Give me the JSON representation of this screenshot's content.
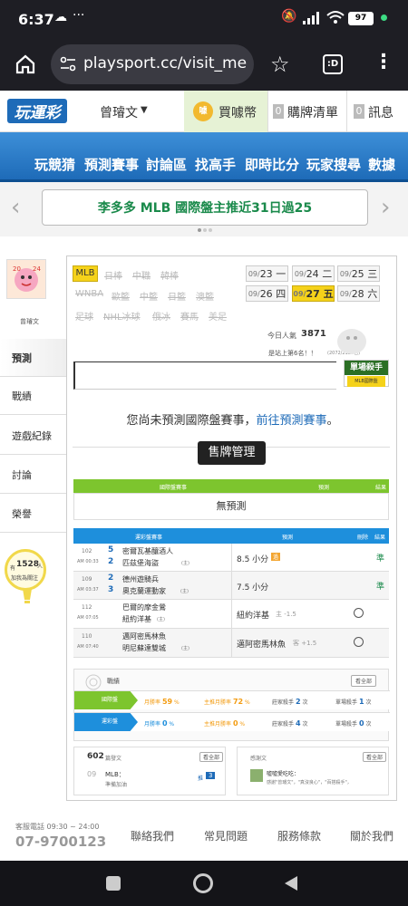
{
  "status": {
    "time": "6:37",
    "battery": "97"
  },
  "browser": {
    "url": "playsport.cc/visit_mer",
    "tab_count": ":D"
  },
  "topnav": {
    "logo": "玩運彩",
    "user": "曾璿文",
    "buy_coin": "買噱幣",
    "cart_count": "0",
    "cart": "購牌清單",
    "msg_count": "0",
    "messages": "訊息"
  },
  "mainnav": [
    "玩競猜",
    "預測賽事",
    "討論區",
    "找高手",
    "即時比分",
    "玩家搜尋",
    "數據"
  ],
  "banner": {
    "text": "李多多 MLB 國際盤主推近31日過25"
  },
  "profile": {
    "name": "曾璿文"
  },
  "sidebar": [
    "預測",
    "戰績",
    "遊戲紀錄",
    "討論",
    "榮譽"
  ],
  "promo": {
    "prefix": "有",
    "count": "1528",
    "unit": "人",
    "sub": "加我為關注"
  },
  "sports": [
    "MLB",
    "日棒",
    "中職",
    "韓棒",
    "WNBA",
    "歐籃",
    "中籃",
    "日籃",
    "澳籃",
    "足球",
    "NHL冰球",
    "俄冰",
    "賽馬",
    "美足"
  ],
  "dates": [
    {
      "md": "09/",
      "d": "23",
      "w": "一"
    },
    {
      "md": "09/",
      "d": "24",
      "w": "二"
    },
    {
      "md": "09/",
      "d": "25",
      "w": "三"
    },
    {
      "md": "09/",
      "d": "26",
      "w": "四"
    },
    {
      "md": "09/",
      "d": "27",
      "w": "五"
    },
    {
      "md": "09/",
      "d": "28",
      "w": "六"
    }
  ],
  "stats": {
    "visitors_label": "今日人氣",
    "visitors": "3871",
    "rank": "是站上第6名！！",
    "rank_sub": "(2072/2124名)"
  },
  "badge": {
    "title": "單場殺手",
    "sub": "MLB國際盤"
  },
  "notice": {
    "text": "您尚未預測國際盤賽事，",
    "link": "前往預測賽事",
    "end": "。"
  },
  "sell_btn": "售牌管理",
  "intl_table": {
    "headers": [
      "國際盤賽事",
      "預測",
      "結果"
    ],
    "empty": "無預測"
  },
  "tw_table": {
    "headers": [
      "運彩盤賽事",
      "預測",
      "刪除",
      "結果"
    ],
    "rows": [
      {
        "no": "102",
        "time": "AM 00:33",
        "s1": "5",
        "s2": "2",
        "t1": "密爾瓦基釀酒人",
        "t2": "匹茲堡海盜",
        "t2_tag": "(主)",
        "pred": "8.5 小分",
        "pred_tag": "過",
        "result": "準"
      },
      {
        "no": "109",
        "time": "AM 03:37",
        "s1": "2",
        "s2": "3",
        "t1": "德州遊騎兵",
        "t2": "奧克蘭運動家",
        "t2_tag": "(主)",
        "pred": "7.5 小分",
        "pred_tag": "",
        "result": "準"
      },
      {
        "no": "112",
        "time": "AM 07:05",
        "s1": "",
        "s2": "",
        "t1": "巴爾的摩金鶯",
        "t2": "紐約洋基",
        "t2_tag": "(主)",
        "pred": "紐約洋基",
        "pred_tag": "主 -1.5",
        "result": ""
      },
      {
        "no": "110",
        "time": "AM 07:40",
        "s1": "",
        "s2": "",
        "t1": "邁阿密馬林魚",
        "t2": "明尼蘇達雙城",
        "t2_tag": "(主)",
        "pred": "邁阿密馬林魚",
        "pred_tag": "客 +1.5",
        "result": ""
      }
    ]
  },
  "record": {
    "title": "戰績",
    "view_all": "看全部",
    "rows": [
      {
        "label": "國際盤",
        "color": "#7dc52e",
        "month": "月勝率",
        "month_v": "59",
        "main": "主推月勝率",
        "main_v": "72",
        "zhuang": "莊家殺手",
        "zhuang_v": "2",
        "single": "單場殺手",
        "single_v": "1",
        "unit": "次"
      },
      {
        "label": "運彩盤",
        "color": "#1e8fdc",
        "month": "月勝率",
        "month_v": "0",
        "main": "主推月勝率",
        "main_v": "0",
        "zhuang": "莊家殺手",
        "zhuang_v": "4",
        "single": "單場殺手",
        "single_v": "0",
        "unit": "次"
      }
    ]
  },
  "posts": {
    "count": "602",
    "label": "篇發文",
    "view_all": "看全部",
    "date": "09",
    "title": "MLB：",
    "sub": "準備加油",
    "badge_label": "推",
    "badge_count": "3"
  },
  "thanks": {
    "title": "感謝文",
    "view_all": "看全部",
    "name": "噓噓愛吃吃：",
    "text": "感謝\"曾璿文\"，\"真沒良心\"，\"百搭殺手\"，"
  },
  "footer": {
    "hotline_label": "客服電話 09:30 ~ 24:00",
    "phone": "07-9700123",
    "links": [
      "聯絡我們",
      "常見問題",
      "服務條款",
      "關於我們"
    ]
  }
}
